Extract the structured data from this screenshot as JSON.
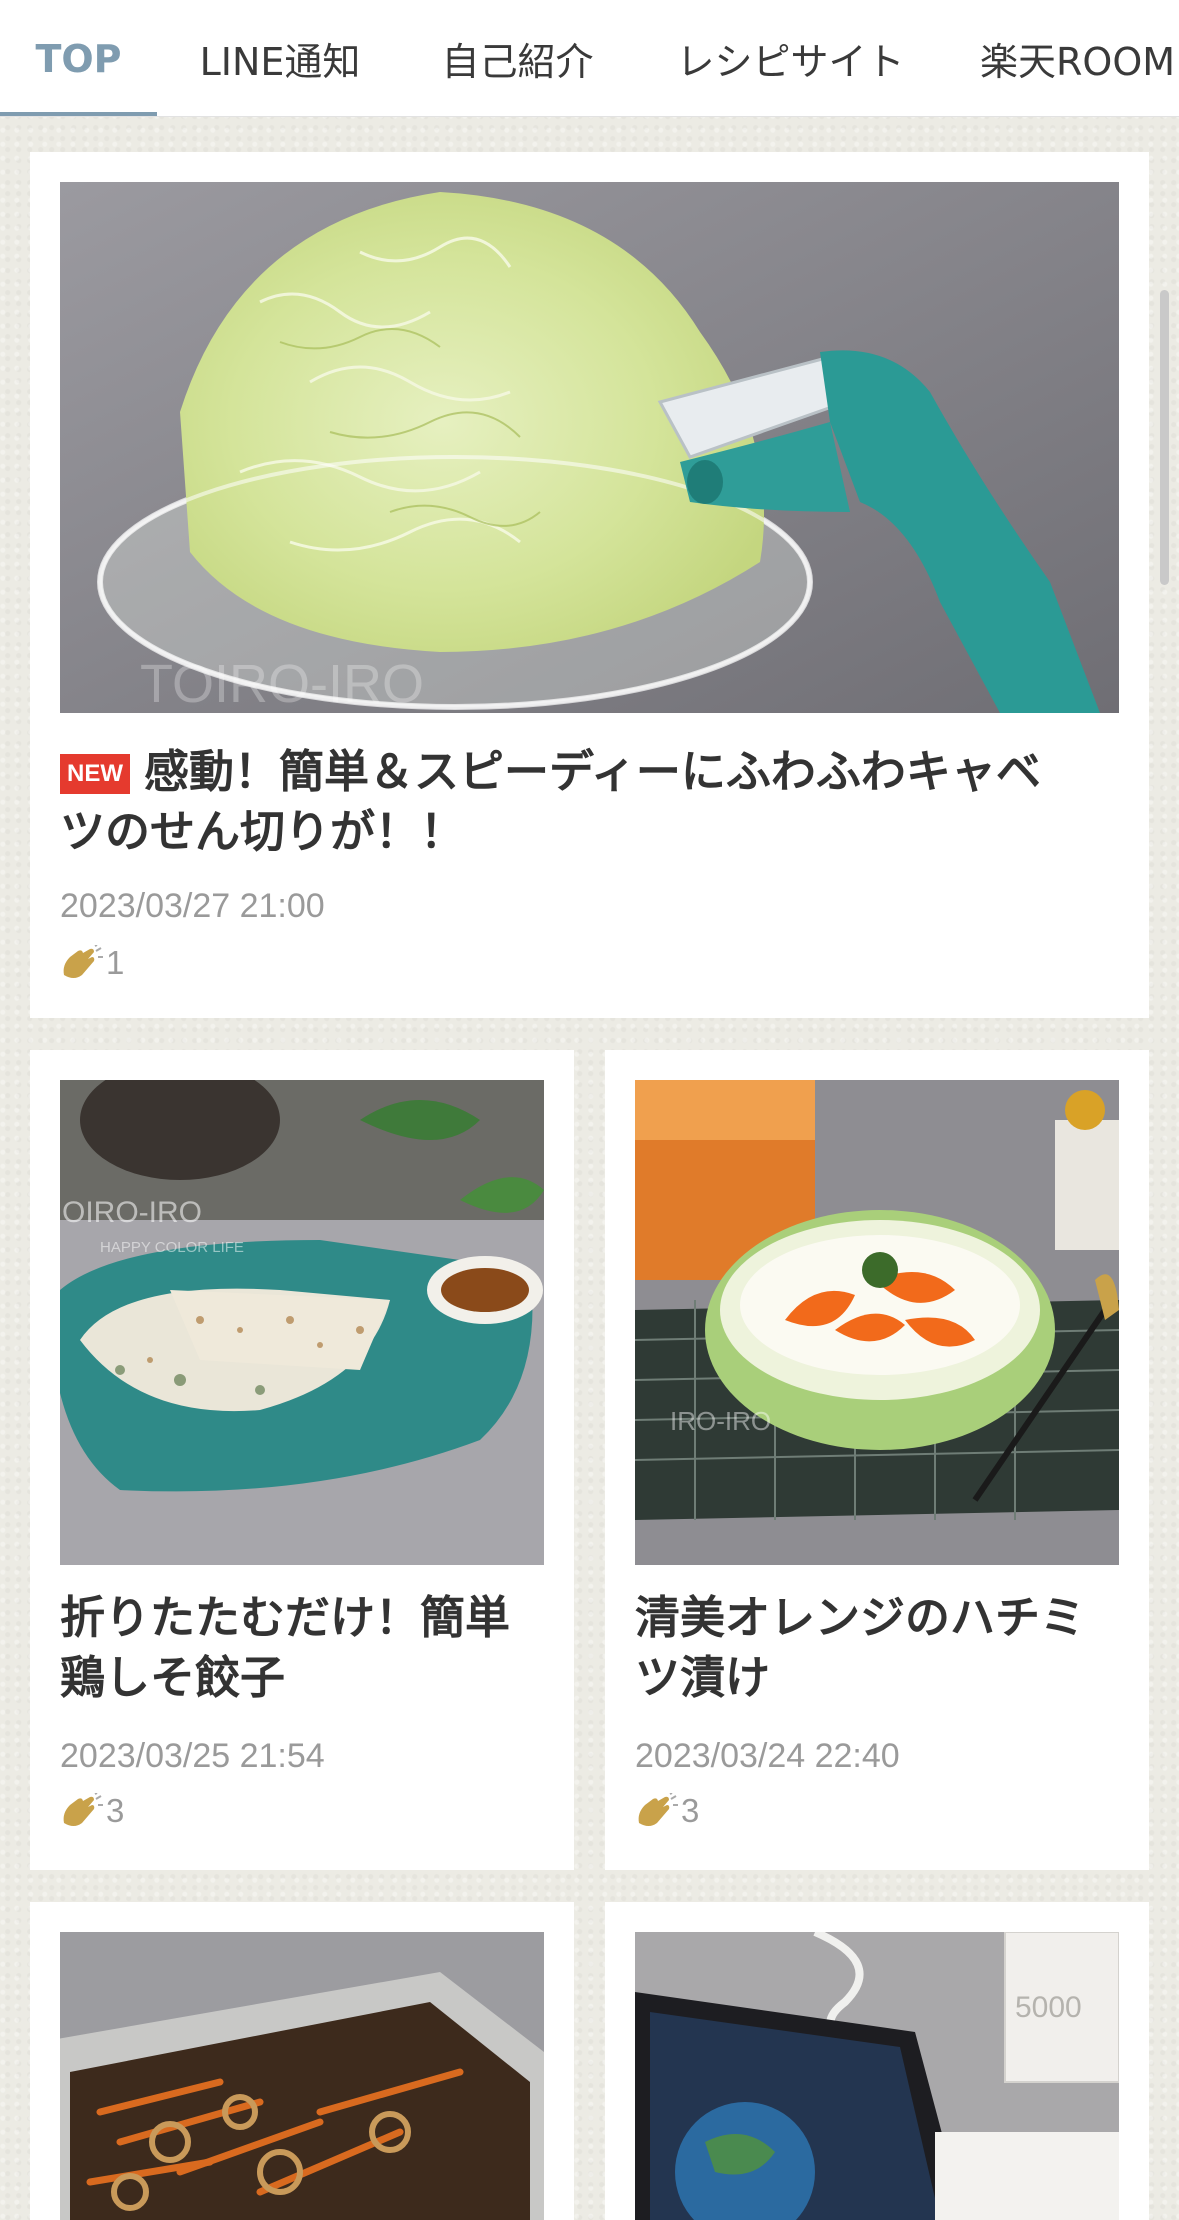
{
  "tabs": [
    {
      "label": "TOP",
      "active": true
    },
    {
      "label": "LINE通知",
      "active": false
    },
    {
      "label": "自己紹介",
      "active": false
    },
    {
      "label": "レシピサイト",
      "active": false
    },
    {
      "label": "楽天ROOM",
      "active": false
    }
  ],
  "colors": {
    "accent": "#7f9cb0",
    "new_badge": "#e53a2e",
    "background": "#ecebe4",
    "card": "#ffffff",
    "date_text": "#9a9a9a"
  },
  "featured": {
    "badge": "NEW",
    "title_line1": "感動！簡単＆スピーディーにふわふわキャベ",
    "title_line2": "ツのせん切りが！！",
    "date": "2023/03/27 21:00",
    "claps": "1",
    "watermark": "TOIRO-IRO",
    "image": "shredded-cabbage-in-glass-bowl-with-green-peeler"
  },
  "posts": [
    {
      "title_line1": "折りたたむだけ！簡単",
      "title_line2": "鶏しそ餃子",
      "date": "2023/03/25 21:54",
      "claps": "3",
      "watermark": "OIRO-IRO",
      "watermark_sub": "HAPPY COLOR LIFE",
      "image": "gyoza-on-teal-plate-with-dipping-sauce"
    },
    {
      "title_line1": "清美オレンジのハチミ",
      "title_line2": "ツ漬け",
      "date": "2023/03/24 22:40",
      "claps": "3",
      "watermark": "IRO-IRO",
      "image": "orange-slices-on-yogurt-in-green-glass-bowl"
    },
    {
      "image": "kinpira-lotus-root-in-steel-tray"
    },
    {
      "box_text": "5000",
      "image": "smartphone-with-power-bank-and-cable"
    }
  ]
}
